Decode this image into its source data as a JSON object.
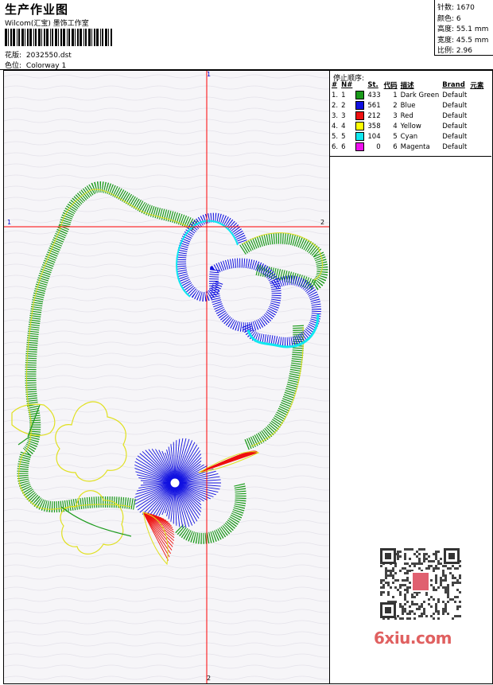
{
  "header": {
    "title": "生产作业图",
    "company": "Wilcom(汇宝) 墨饰工作室",
    "design_label": "花版:",
    "design_value": "2032550.dst",
    "colorway_label": "色位:",
    "colorway_value": "Colorway 1"
  },
  "stats": [
    {
      "label": "针数:",
      "value": "1670"
    },
    {
      "label": "颜色:",
      "value": "6"
    },
    {
      "label": "高度:",
      "value": "55.1 mm"
    },
    {
      "label": "宽度:",
      "value": "45.5 mm"
    },
    {
      "label": "比例:",
      "value": "2.96"
    }
  ],
  "stop_sequence": {
    "title": "停止顺序:",
    "headers": [
      "#",
      "N#",
      "St.",
      "代码",
      "描述",
      "Brand",
      "元素"
    ],
    "rows": [
      {
        "index": "1.",
        "n": "1",
        "color": "#1a9a1a",
        "stitches": "433",
        "code": "1",
        "desc": "Dark Green",
        "brand": "Default"
      },
      {
        "index": "2.",
        "n": "2",
        "color": "#1010e0",
        "stitches": "561",
        "code": "2",
        "desc": "Blue",
        "brand": "Default"
      },
      {
        "index": "3.",
        "n": "3",
        "color": "#ee1010",
        "stitches": "212",
        "code": "3",
        "desc": "Red",
        "brand": "Default"
      },
      {
        "index": "4.",
        "n": "4",
        "color": "#ffff00",
        "stitches": "358",
        "code": "4",
        "desc": "Yellow",
        "brand": "Default"
      },
      {
        "index": "5.",
        "n": "5",
        "color": "#10e8f0",
        "stitches": "104",
        "code": "5",
        "desc": "Cyan",
        "brand": "Default"
      },
      {
        "index": "6.",
        "n": "6",
        "color": "#ee10ee",
        "stitches": "0",
        "code": "6",
        "desc": "Magenta",
        "brand": "Default"
      }
    ]
  },
  "axis_labels": {
    "top": "1",
    "left": "1",
    "right": "2",
    "bottom": "2"
  },
  "watermark": "6xiu.com",
  "colors": {
    "guide": "#ff0000",
    "outline": "#e0e020"
  }
}
